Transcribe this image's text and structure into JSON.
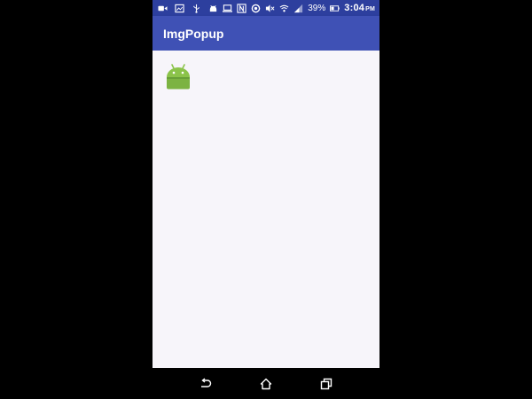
{
  "status_bar": {
    "left_icons": [
      "video-camera-icon",
      "image-icon",
      "usb-icon",
      "android-notification-icon"
    ],
    "right_icons": [
      "laptop-icon",
      "nfc-icon",
      "sync-icon",
      "mute-icon",
      "wifi-icon",
      "signal-icon"
    ],
    "battery_percent": "39%",
    "time": "3:04",
    "time_suffix": "PM"
  },
  "app_bar": {
    "title": "ImgPopup"
  },
  "content": {
    "image_icon": "android-robot-icon"
  },
  "nav_bar": {
    "buttons": [
      "back-icon",
      "home-icon",
      "recents-icon"
    ]
  },
  "colors": {
    "status_bar": "#2d3f9e",
    "app_bar": "#3f51b5",
    "content_bg": "#f7f5fa",
    "android_green": "#8bc34a"
  }
}
